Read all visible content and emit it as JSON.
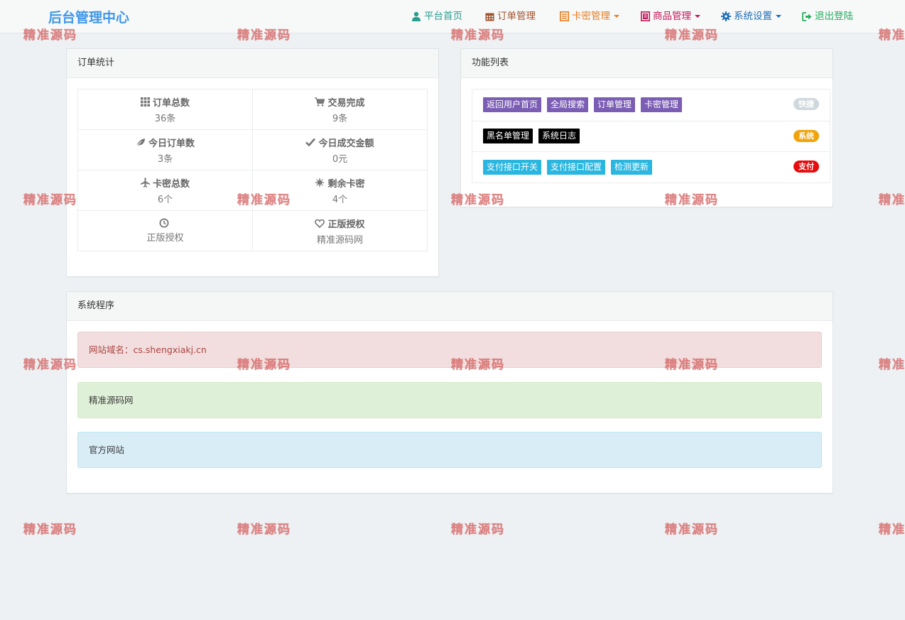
{
  "brand": {
    "title": "后台管理中心",
    "color": "#3f97ea"
  },
  "nav": [
    {
      "label": "平台首页",
      "icon": "user-icon",
      "color": "#2a9d8f",
      "caret": false
    },
    {
      "label": "订单管理",
      "icon": "calendar-icon",
      "color": "#a0522d",
      "caret": false
    },
    {
      "label": "卡密管理",
      "icon": "list-icon",
      "color": "#e67e22",
      "caret": true
    },
    {
      "label": "商品管理",
      "icon": "book-icon",
      "color": "#c2185b",
      "caret": true
    },
    {
      "label": "系统设置",
      "icon": "gear-icon",
      "color": "#1e6fb8",
      "caret": true
    },
    {
      "label": "退出登陆",
      "icon": "logout-icon",
      "color": "#27ae60",
      "caret": false
    }
  ],
  "order_stats": {
    "heading": "订单统计",
    "cells": [
      {
        "label": "订单总数",
        "value": "36条",
        "icon": "grid-icon"
      },
      {
        "label": "交易完成",
        "value": "9条",
        "icon": "cart-icon"
      },
      {
        "label": "今日订单数",
        "value": "3条",
        "icon": "leaf-icon"
      },
      {
        "label": "今日成交金额",
        "value": "0元",
        "icon": "check-icon"
      },
      {
        "label": "卡密总数",
        "value": "6个",
        "icon": "plane-icon"
      },
      {
        "label": "剩余卡密",
        "value": "4个",
        "icon": "sun-icon"
      },
      {
        "label": "",
        "value": "正版授权",
        "icon": "clock-icon"
      },
      {
        "label": "正版授权",
        "value": "精准源码网",
        "icon": "heart-icon"
      }
    ]
  },
  "features": {
    "heading": "功能列表",
    "rows": [
      {
        "badge": "快捷",
        "badge_color": "#cfd8dc",
        "buttons": [
          {
            "label": "返回用户首页",
            "color": "#7b5eb4"
          },
          {
            "label": "全局搜索",
            "color": "#7b5eb4"
          },
          {
            "label": "订单管理",
            "color": "#7b5eb4"
          },
          {
            "label": "卡密管理",
            "color": "#7b5eb4"
          }
        ]
      },
      {
        "badge": "系统",
        "badge_color": "#f0a30a",
        "buttons": [
          {
            "label": "黑名单管理",
            "color": "#000000"
          },
          {
            "label": "系统日志",
            "color": "#000000"
          }
        ]
      },
      {
        "badge": "支付",
        "badge_color": "#e50d0d",
        "buttons": [
          {
            "label": "支付接口开关",
            "color": "#29b6e0"
          },
          {
            "label": "支付接口配置",
            "color": "#29b6e0"
          },
          {
            "label": "检测更新",
            "color": "#29b6e0"
          }
        ]
      }
    ]
  },
  "system": {
    "heading": "系统程序",
    "alerts": [
      {
        "text": "网站域名：cs.shengxiakj.cn",
        "bg": "#f2dede",
        "border": "#ebccd1",
        "color": "#a94442"
      },
      {
        "text": "精准源码网",
        "bg": "#dff0d8",
        "border": "#d6e9c6",
        "color": "#3c3c3c"
      },
      {
        "text": "官方网站",
        "bg": "#d9edf7",
        "border": "#bce8f1",
        "color": "#3c3c3c"
      }
    ]
  },
  "watermark": {
    "text": "精准源码"
  }
}
